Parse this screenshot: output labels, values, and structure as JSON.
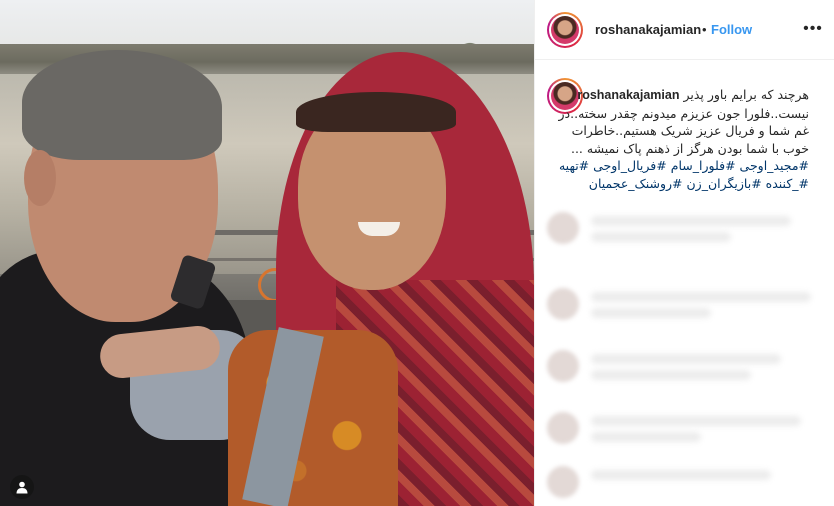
{
  "post": {
    "username": "roshanakajamian",
    "dot": "•",
    "follow_label": "Follow",
    "more_label": "•••",
    "caption": {
      "username": "roshanakajamian",
      "line1": "هرچند که برایم باور پذیر",
      "line2": "نیست..فلورا جون عزیزم میدونم چقدر سخته..در",
      "line3": "غم شما و فریال عزیز شریک هستیم..خاطرات",
      "line4": "خوب با شما بودن هرگز از ذهنم پاک نمیشه ...",
      "tags1": "#مجید_اوجی #فلورا_سام #فریال_اوجی #تهیه",
      "tags2": "#_کننده #بازیگران_زن #روشنک_عجمیان"
    }
  },
  "photo": {
    "tag_icon": "person-icon"
  },
  "colors": {
    "follow": "#3897f0",
    "hashtag": "#003569",
    "text": "#262626"
  }
}
